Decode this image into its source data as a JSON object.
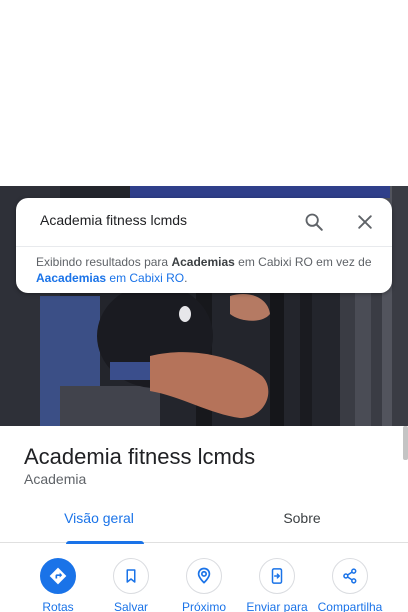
{
  "search": {
    "query": "Academia fitness lcmds",
    "hint": {
      "prefix": "Exibindo resultados para",
      "term": "Academias",
      "middle": "em Cabixi RO em vez de",
      "alt_term": "Aacademias",
      "alt_suffix": "em Cabixi RO",
      "end": "."
    }
  },
  "place": {
    "name": "Academia fitness lcmds",
    "category": "Academia"
  },
  "tabs": [
    {
      "label": "Visão geral",
      "active": true
    },
    {
      "label": "Sobre",
      "active": false
    }
  ],
  "actions": [
    {
      "label": "Rotas",
      "icon": "directions-icon"
    },
    {
      "label": "Salvar",
      "icon": "bookmark-icon"
    },
    {
      "label": "Próximo",
      "icon": "nearby-icon"
    },
    {
      "label": "Enviar para",
      "icon": "send-to-phone-icon"
    },
    {
      "label": "Compartilha",
      "icon": "share-icon"
    }
  ],
  "colors": {
    "accent": "#1a73e8",
    "text": "#202124",
    "secondary_text": "#5f6368"
  }
}
